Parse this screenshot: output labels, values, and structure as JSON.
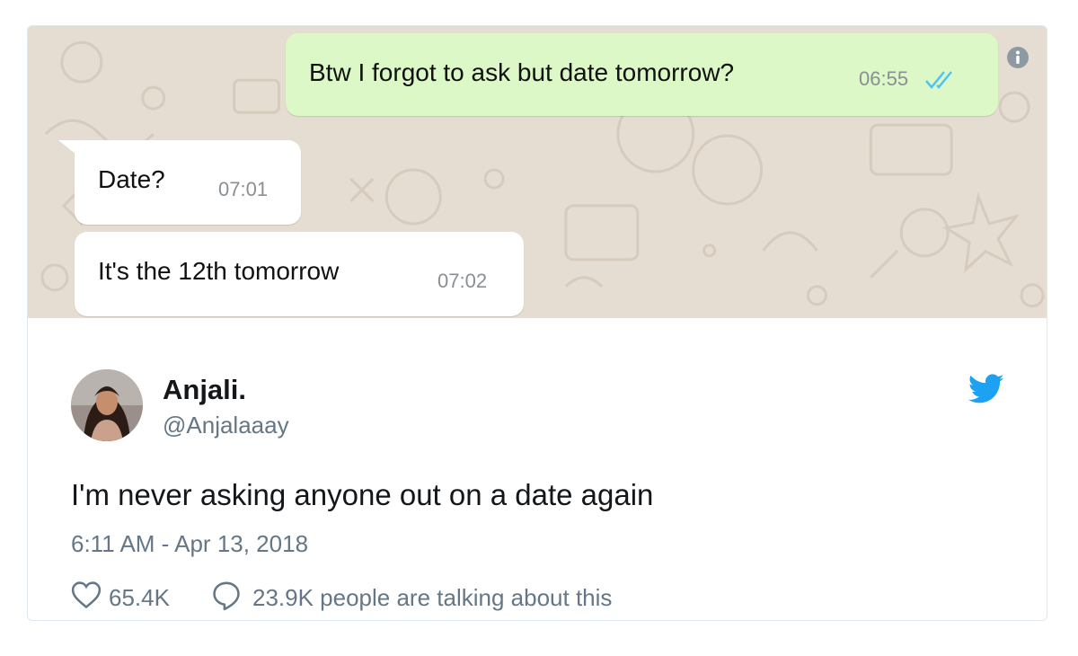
{
  "chat": {
    "messages": [
      {
        "direction": "outgoing",
        "text": "Btw I forgot to ask but date tomorrow?",
        "time": "06:55",
        "status_icon": "double-check-read-icon"
      },
      {
        "direction": "incoming",
        "text": "Date?",
        "time": "07:01"
      },
      {
        "direction": "incoming",
        "text": "It's the 12th tomorrow",
        "time": "07:02"
      }
    ],
    "colors": {
      "background": "#e5ddd2",
      "outgoing_bubble": "#dcf8c6",
      "incoming_bubble": "#ffffff",
      "read_ticks": "#4fc3f7"
    }
  },
  "tweet": {
    "author_name": "Anjali.",
    "author_handle": "@Anjalaaay",
    "text": "I'm never asking anyone out on a date again",
    "timestamp": "6:11 AM - Apr 13, 2018",
    "likes": "65.4K",
    "talking": "23.9K people are talking about this",
    "icons": {
      "brand": "twitter-bird-icon",
      "like": "heart-icon",
      "reply": "reply-bubble-icon",
      "info": "info-icon"
    },
    "colors": {
      "brand": "#1da1f2",
      "secondary_text": "#657786"
    }
  }
}
